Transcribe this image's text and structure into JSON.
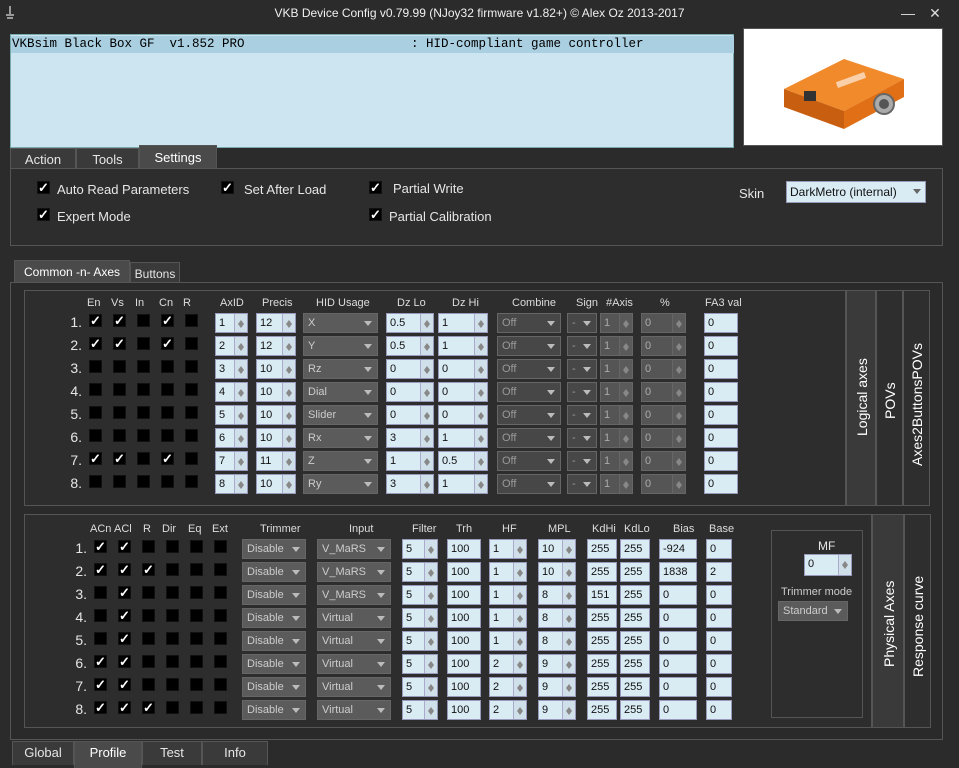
{
  "window": {
    "title": "VKB Device Config v0.79.99 (NJoy32 firmware v1.82+) © Alex Oz 2013-2017",
    "minimize": "—",
    "close": "✕"
  },
  "device": {
    "name": "VKBsim Black Box GF  v1.852 PRO",
    "type": ": HID-compliant game controller"
  },
  "main_tabs": [
    "Action",
    "Tools",
    "Settings"
  ],
  "settings": {
    "auto_read": "Auto Read Parameters",
    "set_after_load": "Set After Load",
    "partial_write": "Partial Write",
    "expert_mode": "Expert Mode",
    "partial_calibration": "Partial Calibration",
    "skin_label": "Skin",
    "skin_value": "DarkMetro (internal)"
  },
  "sub_tabs": [
    "Common -n- Axes",
    "Buttons"
  ],
  "logical": {
    "headers": [
      "En",
      "Vs",
      "In",
      "Cn",
      "R",
      "AxID",
      "Precis",
      "HID Usage",
      "Dz Lo",
      "Dz Hi",
      "Combine",
      "Sign",
      "#Axis",
      "%",
      "FA3 val"
    ],
    "rows": [
      {
        "n": "1.",
        "en": true,
        "vs": true,
        "in": false,
        "cn": true,
        "r": false,
        "axid": "1",
        "precis": "12",
        "usage": "X",
        "dzlo": "0.5",
        "dzhi": "1",
        "combine": "Off",
        "sign": "-",
        "axis": "1",
        "pct": "0",
        "fa3": "0"
      },
      {
        "n": "2.",
        "en": true,
        "vs": true,
        "in": false,
        "cn": true,
        "r": false,
        "axid": "2",
        "precis": "12",
        "usage": "Y",
        "dzlo": "0.5",
        "dzhi": "1",
        "combine": "Off",
        "sign": "-",
        "axis": "1",
        "pct": "0",
        "fa3": "0"
      },
      {
        "n": "3.",
        "en": false,
        "vs": false,
        "in": false,
        "cn": false,
        "r": false,
        "axid": "3",
        "precis": "10",
        "usage": "Rz",
        "dzlo": "0",
        "dzhi": "0",
        "combine": "Off",
        "sign": "-",
        "axis": "1",
        "pct": "0",
        "fa3": "0"
      },
      {
        "n": "4.",
        "en": false,
        "vs": false,
        "in": false,
        "cn": false,
        "r": false,
        "axid": "4",
        "precis": "10",
        "usage": "Dial",
        "dzlo": "0",
        "dzhi": "0",
        "combine": "Off",
        "sign": "-",
        "axis": "1",
        "pct": "0",
        "fa3": "0"
      },
      {
        "n": "5.",
        "en": false,
        "vs": false,
        "in": false,
        "cn": false,
        "r": false,
        "axid": "5",
        "precis": "10",
        "usage": "Slider",
        "dzlo": "0",
        "dzhi": "0",
        "combine": "Off",
        "sign": "-",
        "axis": "1",
        "pct": "0",
        "fa3": "0"
      },
      {
        "n": "6.",
        "en": false,
        "vs": false,
        "in": false,
        "cn": false,
        "r": false,
        "axid": "6",
        "precis": "10",
        "usage": "Rx",
        "dzlo": "3",
        "dzhi": "1",
        "combine": "Off",
        "sign": "-",
        "axis": "1",
        "pct": "0",
        "fa3": "0"
      },
      {
        "n": "7.",
        "en": true,
        "vs": true,
        "in": false,
        "cn": true,
        "r": false,
        "axid": "7",
        "precis": "11",
        "usage": "Z",
        "dzlo": "1",
        "dzhi": "0.5",
        "combine": "Off",
        "sign": "-",
        "axis": "1",
        "pct": "0",
        "fa3": "0"
      },
      {
        "n": "8.",
        "en": false,
        "vs": false,
        "in": false,
        "cn": false,
        "r": false,
        "axid": "8",
        "precis": "10",
        "usage": "Ry",
        "dzlo": "3",
        "dzhi": "1",
        "combine": "Off",
        "sign": "-",
        "axis": "1",
        "pct": "0",
        "fa3": "0"
      }
    ],
    "side_tabs": [
      "Logical axes",
      "POVs",
      "Axes2ButtonsPOVs"
    ]
  },
  "physical": {
    "headers": [
      "ACn",
      "ACl",
      "R",
      "Dir",
      "Eq",
      "Ext",
      "Trimmer",
      "Input",
      "Filter",
      "Trh",
      "HF",
      "MPL",
      "KdHi",
      "KdLo",
      "Bias",
      "Base"
    ],
    "rows": [
      {
        "n": "1.",
        "acn": true,
        "acl": true,
        "r": false,
        "dir": false,
        "eq": false,
        "ext": false,
        "trimmer": "Disable",
        "input": "V_MaRS",
        "filter": "5",
        "trh": "100",
        "hf": "1",
        "mpl": "10",
        "kdhi": "255",
        "kdlo": "255",
        "bias": "-924",
        "base": "0"
      },
      {
        "n": "2.",
        "acn": true,
        "acl": true,
        "r": true,
        "dir": false,
        "eq": false,
        "ext": false,
        "trimmer": "Disable",
        "input": "V_MaRS",
        "filter": "5",
        "trh": "100",
        "hf": "1",
        "mpl": "10",
        "kdhi": "255",
        "kdlo": "255",
        "bias": "1838",
        "base": "2"
      },
      {
        "n": "3.",
        "acn": false,
        "acl": true,
        "r": false,
        "dir": false,
        "eq": false,
        "ext": false,
        "trimmer": "Disable",
        "input": "V_MaRS",
        "filter": "5",
        "trh": "100",
        "hf": "1",
        "mpl": "8",
        "kdhi": "151",
        "kdlo": "255",
        "bias": "0",
        "base": "0"
      },
      {
        "n": "4.",
        "acn": false,
        "acl": true,
        "r": false,
        "dir": false,
        "eq": false,
        "ext": false,
        "trimmer": "Disable",
        "input": "Virtual",
        "filter": "5",
        "trh": "100",
        "hf": "1",
        "mpl": "8",
        "kdhi": "255",
        "kdlo": "255",
        "bias": "0",
        "base": "0"
      },
      {
        "n": "5.",
        "acn": false,
        "acl": true,
        "r": false,
        "dir": false,
        "eq": false,
        "ext": false,
        "trimmer": "Disable",
        "input": "Virtual",
        "filter": "5",
        "trh": "100",
        "hf": "1",
        "mpl": "8",
        "kdhi": "255",
        "kdlo": "255",
        "bias": "0",
        "base": "0"
      },
      {
        "n": "6.",
        "acn": true,
        "acl": true,
        "r": false,
        "dir": false,
        "eq": false,
        "ext": false,
        "trimmer": "Disable",
        "input": "Virtual",
        "filter": "5",
        "trh": "100",
        "hf": "2",
        "mpl": "9",
        "kdhi": "255",
        "kdlo": "255",
        "bias": "0",
        "base": "0"
      },
      {
        "n": "7.",
        "acn": true,
        "acl": true,
        "r": false,
        "dir": false,
        "eq": false,
        "ext": false,
        "trimmer": "Disable",
        "input": "Virtual",
        "filter": "5",
        "trh": "100",
        "hf": "2",
        "mpl": "9",
        "kdhi": "255",
        "kdlo": "255",
        "bias": "0",
        "base": "0"
      },
      {
        "n": "8.",
        "acn": true,
        "acl": true,
        "r": true,
        "dir": false,
        "eq": false,
        "ext": false,
        "trimmer": "Disable",
        "input": "Virtual",
        "filter": "5",
        "trh": "100",
        "hf": "2",
        "mpl": "9",
        "kdhi": "255",
        "kdlo": "255",
        "bias": "0",
        "base": "0"
      }
    ],
    "mf_label": "MF",
    "mf_value": "0",
    "trimmer_mode_label": "Trimmer mode",
    "trimmer_mode_value": "Standard",
    "side_tabs": [
      "Physical Axes",
      "Response curve"
    ]
  },
  "bottom_tabs": [
    "Global",
    "Profile",
    "Test",
    "Info"
  ],
  "colors": {
    "bg": "#2b2b2b",
    "field": "#d9ebf3",
    "device_list": "#cde5f0",
    "device_highlight": "#a9cfe0",
    "device_box": "#e87a1c"
  }
}
